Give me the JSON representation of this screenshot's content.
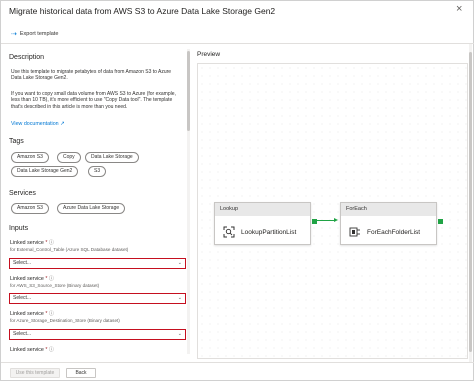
{
  "dialog": {
    "title": "Migrate historical data from AWS S3 to Azure Data Lake Storage Gen2",
    "close_glyph": "×"
  },
  "toolbar": {
    "export_label": "Export template",
    "export_icon": "export-arrow-icon"
  },
  "description": {
    "heading": "Description",
    "para1": "Use this template to migrate petabytes of data from Amazon S3 to Azure Data Lake Storage Gen2.",
    "para2": "If you want to copy small data volume from AWS S3 to Azure (for example, less than 10 TB), it's more efficient to use \"Copy Data tool\". The template that's described in this article is more than you need.",
    "view_doc": "View documentation"
  },
  "tags": {
    "heading": "Tags",
    "items": [
      "Amazon S3",
      "Copy",
      "Data Lake Storage",
      "Data Lake Storage Gen2",
      "S3"
    ]
  },
  "services": {
    "heading": "Services",
    "items": [
      "Amazon S3",
      "Azure Data Lake Storage"
    ]
  },
  "inputs": {
    "heading": "Inputs",
    "linked_services": [
      {
        "label": "Linked service",
        "sub": "for External_Control_Table (Azure SQL Database dataset)",
        "value": "Select..."
      },
      {
        "label": "Linked service",
        "sub": "for AWS_S3_Source_Store (Binary dataset)",
        "value": "Select..."
      },
      {
        "label": "Linked service",
        "sub": "for Azure_Storage_Destination_Store (Binary dataset)",
        "value": "Select..."
      },
      {
        "label": "Linked service",
        "sub": "",
        "value": ""
      }
    ],
    "required_mark": "*",
    "info_glyph": "ⓘ"
  },
  "preview": {
    "heading": "Preview",
    "nodes": [
      {
        "header": "Lookup",
        "name": "LookupPartitionList",
        "icon": "lookup-icon"
      },
      {
        "header": "ForEach",
        "name": "ForEachFolderList",
        "icon": "foreach-icon"
      }
    ]
  },
  "footer": {
    "use_template": "Use this template",
    "back": "Back"
  },
  "colors": {
    "accent": "#0078d4",
    "error_border": "#c50f1f",
    "activity_port": "#20a345"
  }
}
